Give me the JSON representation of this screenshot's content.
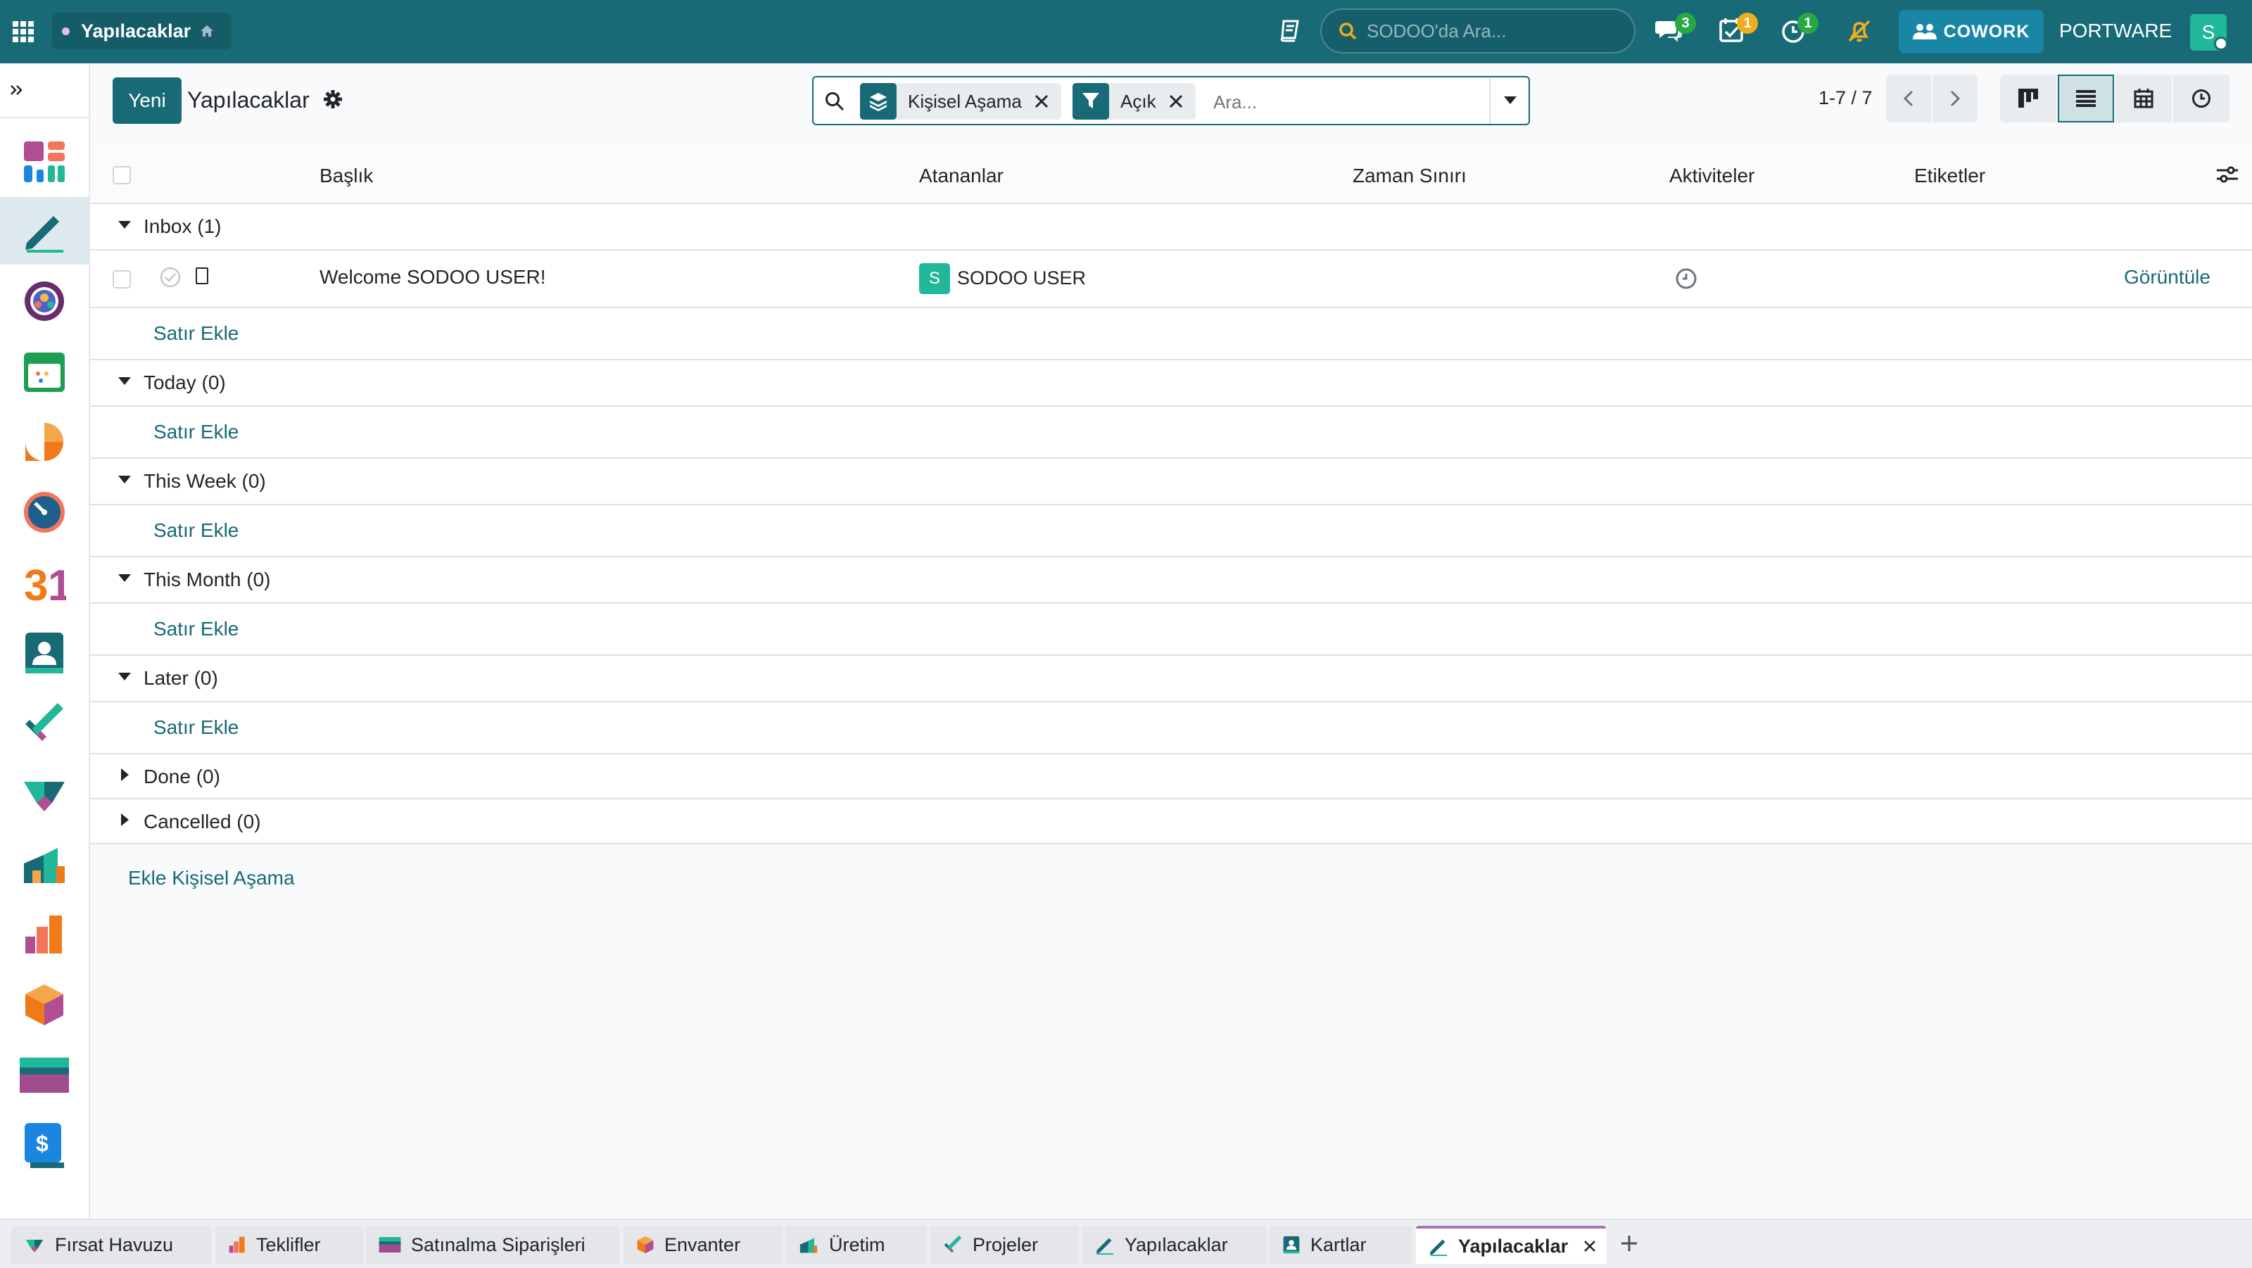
{
  "topbar": {
    "app_name": "Yapılacaklar",
    "search_placeholder": "SODOO'da Ara...",
    "messages_count": "3",
    "activities_count": "1",
    "timer_count": "1",
    "cowork_label": "COWORK",
    "company_label": "PORTWARE",
    "user_initial": "S"
  },
  "control": {
    "new_label": "Yeni",
    "title": "Yapılacaklar",
    "facets": [
      "Kişisel Aşama",
      "Açık"
    ],
    "search_placeholder": "Ara...",
    "pager": "1-7 / 7"
  },
  "list": {
    "columns": [
      "Başlık",
      "Atananlar",
      "Zaman Sınırı",
      "Aktiviteler",
      "Etiketler"
    ],
    "groups": [
      {
        "label": "Inbox (1)",
        "open": true
      },
      {
        "label": "Today (0)",
        "open": true
      },
      {
        "label": "This Week (0)",
        "open": true
      },
      {
        "label": "This Month (0)",
        "open": true
      },
      {
        "label": "Later (0)",
        "open": true
      },
      {
        "label": "Done (0)",
        "open": false
      },
      {
        "label": "Cancelled (0)",
        "open": false
      }
    ],
    "record": {
      "title": "Welcome SODOO USER!",
      "assignee_initial": "S",
      "assignee": "SODOO USER",
      "view_label": "Görüntüle"
    },
    "add_line_label": "Satır Ekle",
    "add_stage_label": "Ekle Kişisel Aşama"
  },
  "tabs": [
    {
      "label": "Fırsat Havuzu",
      "icon": "crm-icon"
    },
    {
      "label": "Teklifler",
      "icon": "sales-icon"
    },
    {
      "label": "Satınalma Siparişleri",
      "icon": "purchase-icon"
    },
    {
      "label": "Envanter",
      "icon": "inventory-icon"
    },
    {
      "label": "Üretim",
      "icon": "manufacturing-icon"
    },
    {
      "label": "Projeler",
      "icon": "project-icon"
    },
    {
      "label": "Yapılacaklar",
      "icon": "todo-icon"
    },
    {
      "label": "Kartlar",
      "icon": "contacts-icon"
    },
    {
      "label": "Yapılacaklar",
      "icon": "todo-icon",
      "active": true
    }
  ],
  "colors": {
    "brand": "#176a76",
    "badge_green": "#28a745",
    "badge_yellow": "#f0ad1e",
    "cowork": "#1a86a6"
  }
}
